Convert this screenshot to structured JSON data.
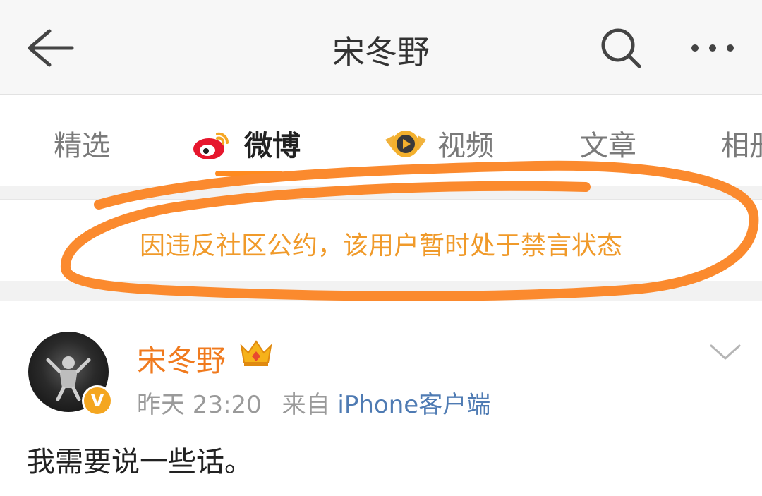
{
  "header": {
    "title": "宋冬野"
  },
  "tabs": [
    {
      "label": "精选"
    },
    {
      "label": "微博"
    },
    {
      "label": "视频"
    },
    {
      "label": "文章"
    },
    {
      "label": "相册"
    }
  ],
  "notice": {
    "text": "因违反社区公约，该用户暂时处于禁言状态"
  },
  "post": {
    "username": "宋冬野",
    "time": "昨天 23:20",
    "from_label": "来自",
    "source": "iPhone客户端",
    "verified_badge": "V",
    "content": "我需要说一些话。"
  },
  "colors": {
    "accent": "#ff8a1f",
    "notice_text": "#f09a2a",
    "username": "#f07a1e",
    "source_link": "#4f7bb3",
    "scribble": "#fb8a2e"
  }
}
